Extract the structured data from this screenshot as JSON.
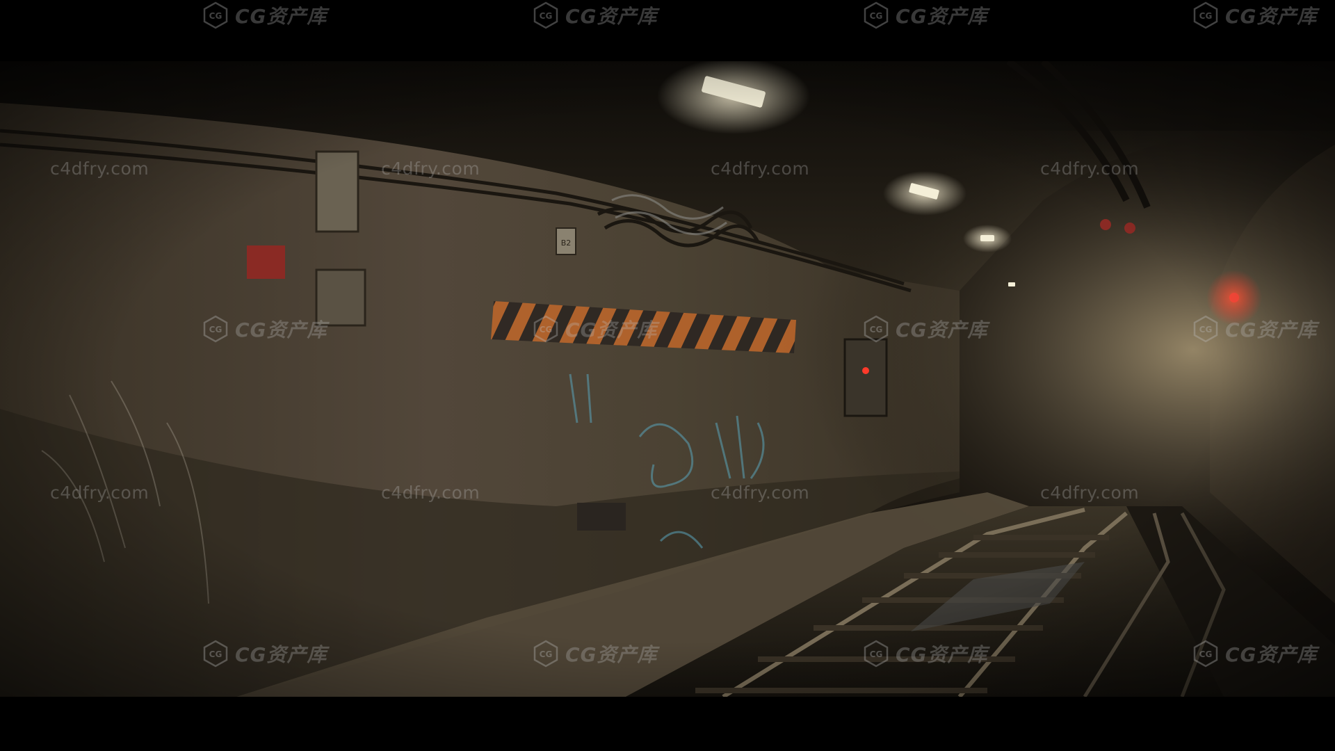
{
  "scene": {
    "palette": {
      "wall": "#4a4032",
      "wall_dark": "#1e1a14",
      "fog": "#8a7a5e",
      "hazard_orange": "#c0672a",
      "hazard_dark": "#2a2420",
      "light": "#f4efd8",
      "signal_red": "#ff3a2a",
      "graffiti_blue": "#5aa3b8"
    },
    "wall_sign_text": "B2"
  },
  "watermarks": {
    "url_text": "c4dfry.com",
    "brand_text": "CG资产库"
  }
}
